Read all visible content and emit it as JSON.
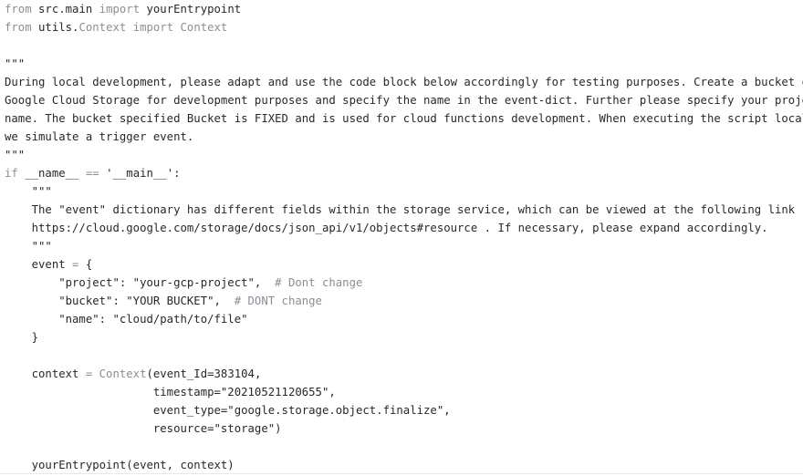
{
  "code": {
    "lines": [
      [
        {
          "t": "from",
          "c": "kw"
        },
        {
          "t": " src.main ",
          "c": "plain"
        },
        {
          "t": "import",
          "c": "kw"
        },
        {
          "t": " yourEntrypoint",
          "c": "plain"
        }
      ],
      [
        {
          "t": "from",
          "c": "kw"
        },
        {
          "t": " utils.",
          "c": "plain"
        },
        {
          "t": "Context",
          "c": "dim"
        },
        {
          "t": " ",
          "c": "plain"
        },
        {
          "t": "import",
          "c": "kw"
        },
        {
          "t": " ",
          "c": "plain"
        },
        {
          "t": "Context",
          "c": "dim"
        }
      ],
      [],
      [
        {
          "t": "\"\"\"",
          "c": "plain"
        }
      ],
      [
        {
          "t": "During local development, please adapt and use the code block below accordingly for testing purposes. Create a bucket on",
          "c": "plain"
        }
      ],
      [
        {
          "t": "Google Cloud Storage for development purposes and specify the name in the event-dict. Further please specify your project",
          "c": "plain"
        }
      ],
      [
        {
          "t": "name. The bucket specified Bucket is FIXED and is used for cloud functions development. When executing the script locally",
          "c": "plain"
        }
      ],
      [
        {
          "t": "we simulate a trigger event.",
          "c": "plain"
        }
      ],
      [
        {
          "t": "\"\"\"",
          "c": "plain"
        }
      ],
      [
        {
          "t": "if",
          "c": "kw"
        },
        {
          "t": " __name__ ",
          "c": "plain"
        },
        {
          "t": "==",
          "c": "dim"
        },
        {
          "t": " '__main__':",
          "c": "plain"
        }
      ],
      [
        {
          "t": "    \"\"\"",
          "c": "plain"
        }
      ],
      [
        {
          "t": "    The \"event\" dictionary has different fields within the storage service, which can be viewed at the following link",
          "c": "plain"
        }
      ],
      [
        {
          "t": "    https://cloud.google.com/storage/docs/json_api/v1/objects#resource . If necessary, please expand accordingly.",
          "c": "plain"
        }
      ],
      [
        {
          "t": "    \"\"\"",
          "c": "plain"
        }
      ],
      [
        {
          "t": "    event ",
          "c": "plain"
        },
        {
          "t": "=",
          "c": "dim"
        },
        {
          "t": " {",
          "c": "plain"
        }
      ],
      [
        {
          "t": "        \"project\": \"your-gcp-project\",  ",
          "c": "plain"
        },
        {
          "t": "# Dont change",
          "c": "cm"
        }
      ],
      [
        {
          "t": "        \"bucket\": \"YOUR BUCKET\",  ",
          "c": "plain"
        },
        {
          "t": "# DONT change",
          "c": "cm"
        }
      ],
      [
        {
          "t": "        \"name\": \"cloud/path/to/file\"",
          "c": "plain"
        }
      ],
      [
        {
          "t": "    }",
          "c": "plain"
        }
      ],
      [],
      [
        {
          "t": "    context ",
          "c": "plain"
        },
        {
          "t": "=",
          "c": "dim"
        },
        {
          "t": " ",
          "c": "plain"
        },
        {
          "t": "Context",
          "c": "dim"
        },
        {
          "t": "(event_Id=383104,",
          "c": "plain"
        }
      ],
      [
        {
          "t": "                      timestamp=\"20210521120655\",",
          "c": "plain"
        }
      ],
      [
        {
          "t": "                      event_type=\"google.storage.object.finalize\",",
          "c": "plain"
        }
      ],
      [
        {
          "t": "                      resource=\"storage\")",
          "c": "plain"
        }
      ],
      [],
      [
        {
          "t": "    yourEntrypoint(event, context)",
          "c": "plain"
        }
      ]
    ]
  }
}
